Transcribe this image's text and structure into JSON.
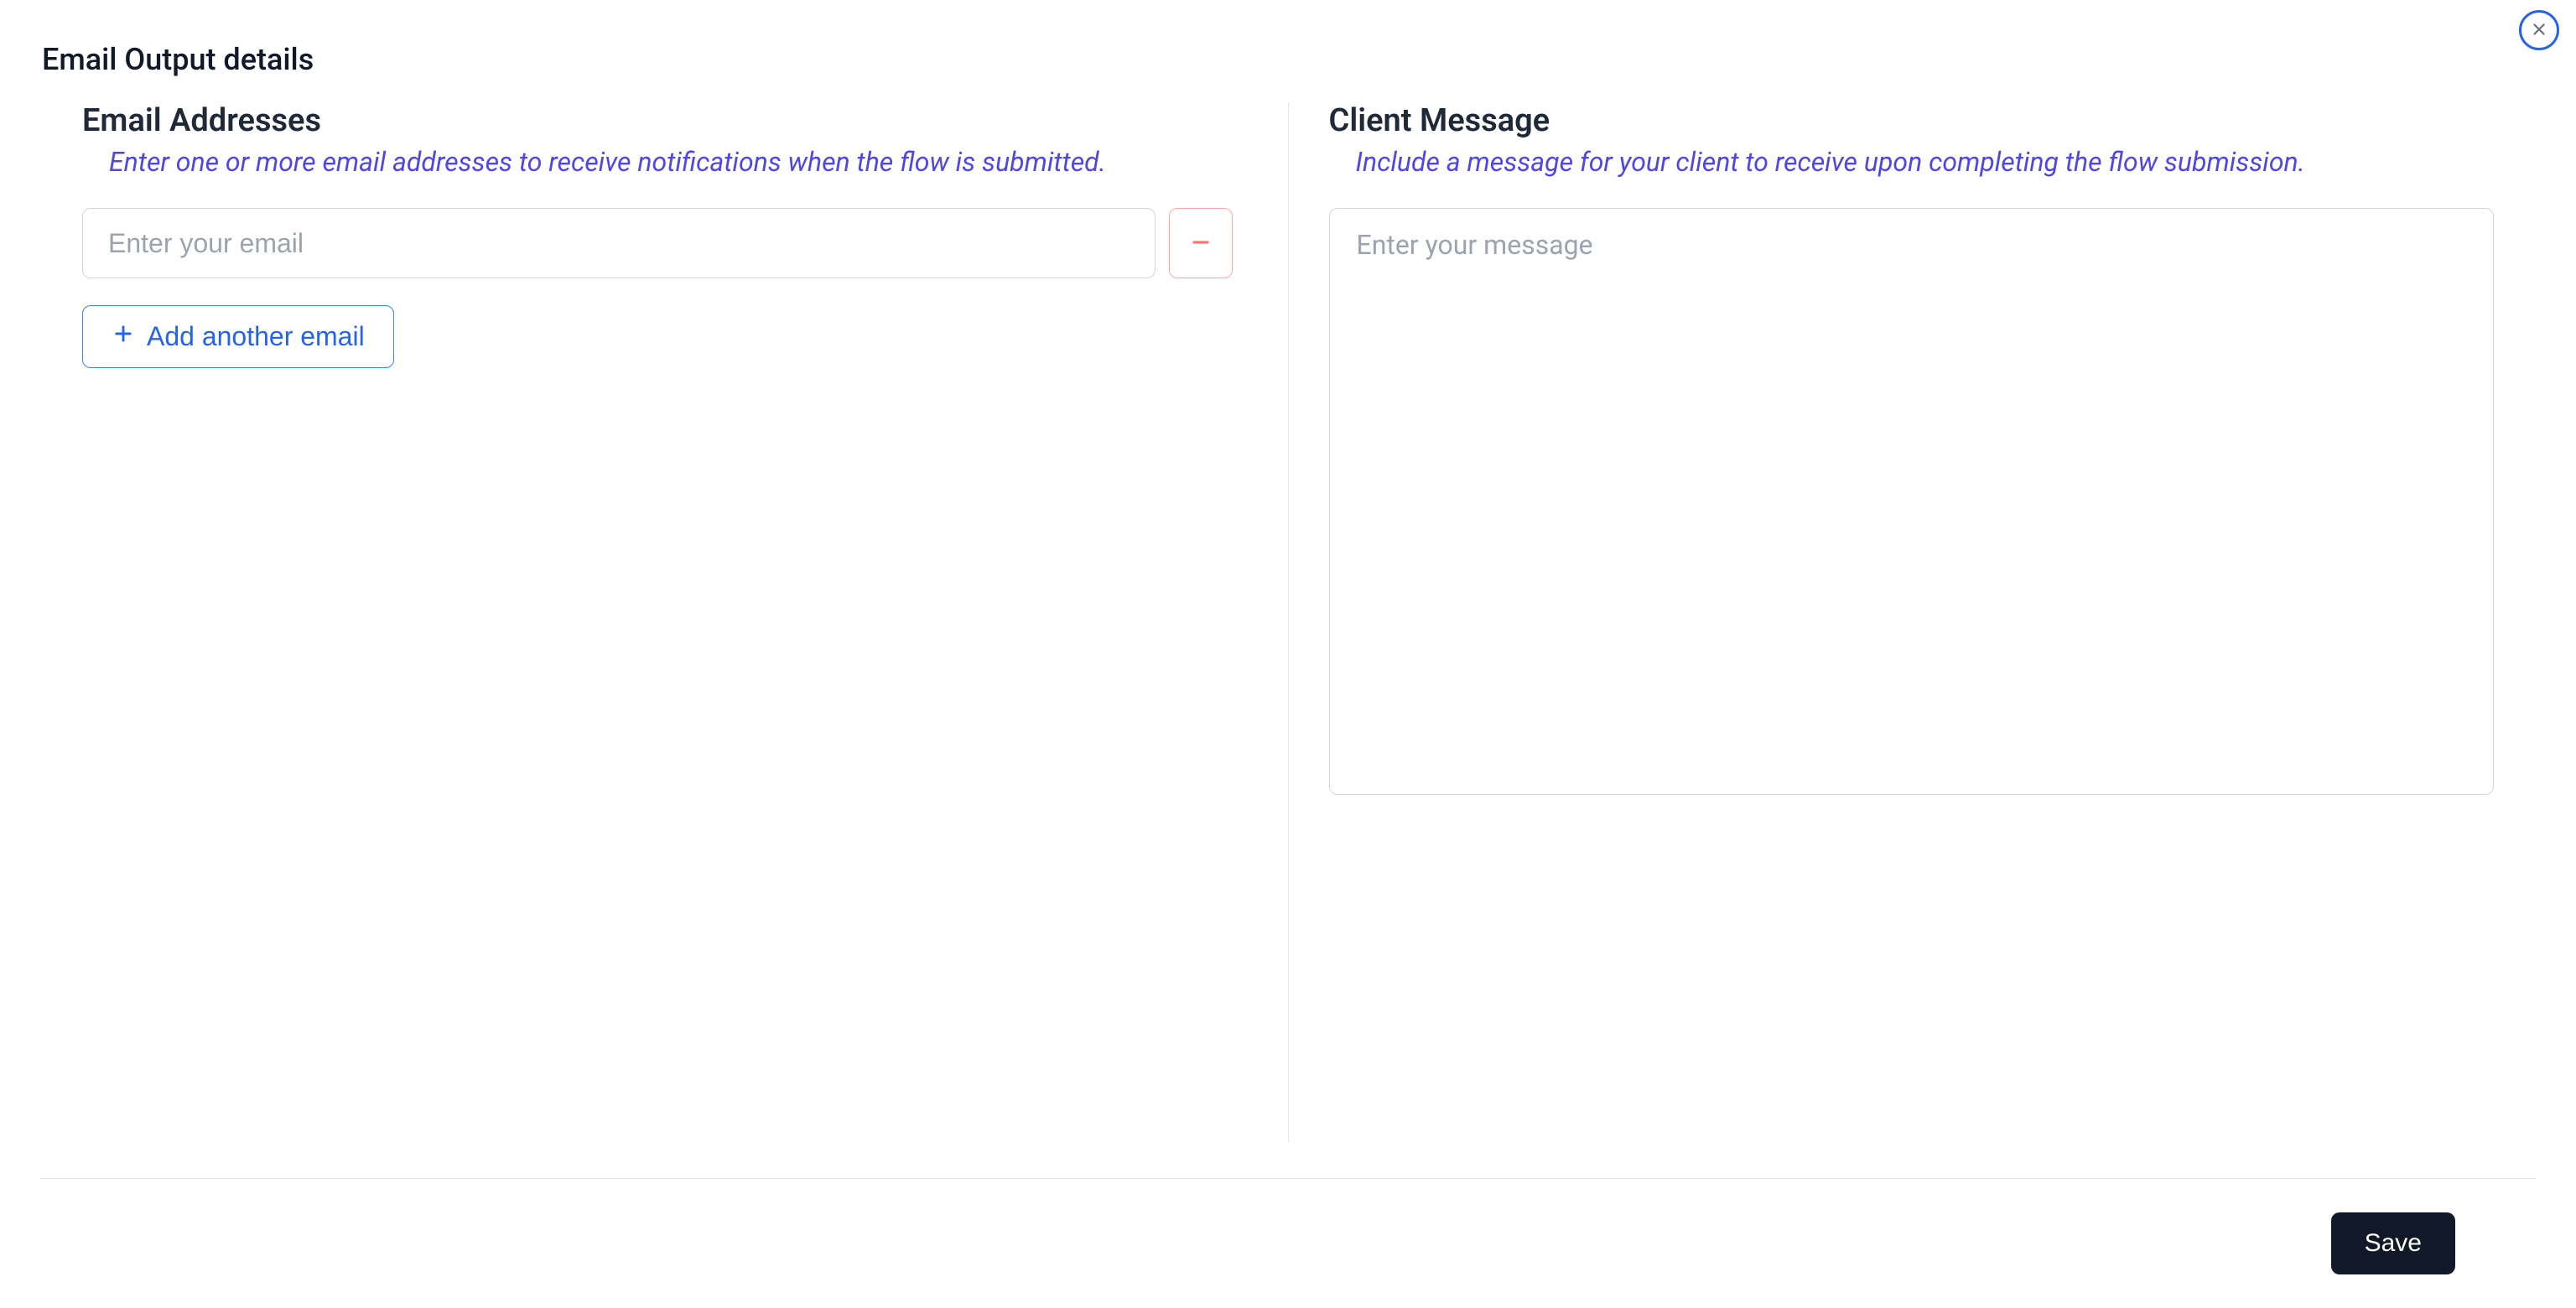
{
  "modal": {
    "title": "Email Output details",
    "close_icon": "close"
  },
  "email_section": {
    "heading": "Email Addresses",
    "subtext": "Enter one or more email addresses to receive notifications when the flow is submitted.",
    "placeholder": "Enter your email",
    "value": "",
    "add_button_label": "Add another email"
  },
  "message_section": {
    "heading": "Client Message",
    "subtext": "Include a message for your client to receive upon completing the flow submission.",
    "placeholder": "Enter your message",
    "value": ""
  },
  "footer": {
    "save_label": "Save"
  }
}
